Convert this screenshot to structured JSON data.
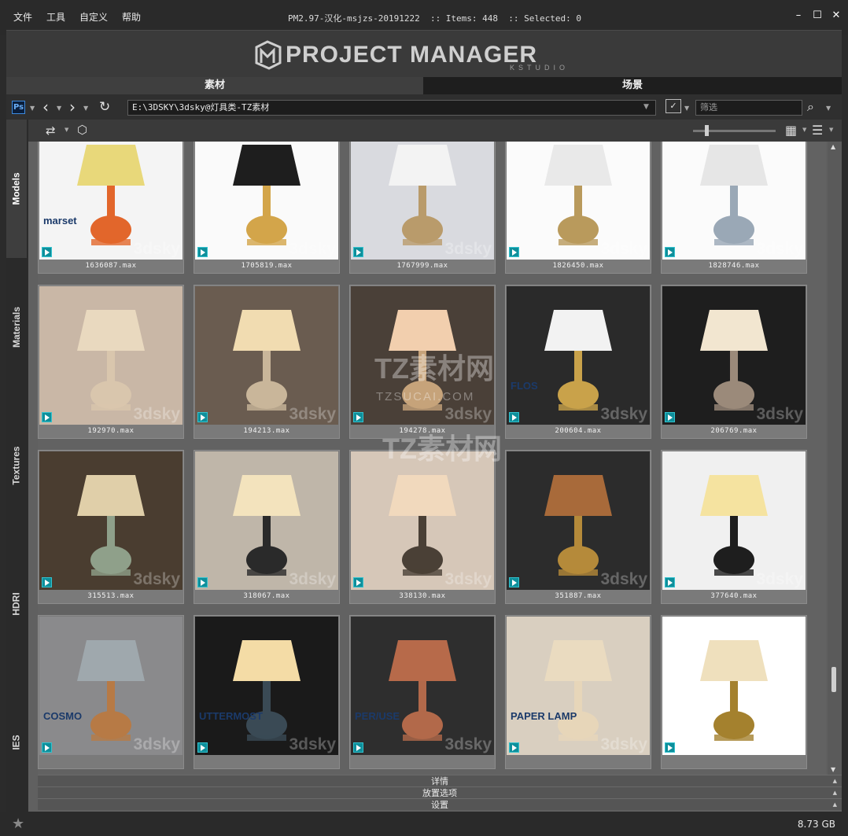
{
  "menu": [
    "文件",
    "工具",
    "自定义",
    "帮助"
  ],
  "app_info": "PM2.97-汉化-msjzs-20191222  :: Items: 448  :: Selected: 0",
  "window_controls": [
    "–",
    "☐",
    "✕"
  ],
  "banner": {
    "title": "PROJECT MANAGER",
    "subtitle": "KSTUDIO"
  },
  "tabs": {
    "materials": "素材",
    "scenes": "场景"
  },
  "addressbar": {
    "ps_label": "Ps",
    "path": "E:\\3DSKY\\3dsky@灯具类-TZ素材",
    "filter_placeholder": "筛选"
  },
  "sidetabs": [
    "Models",
    "Materials",
    "Textures",
    "HDRI",
    "IES"
  ],
  "watermark_text": "3dsky",
  "overlay": {
    "main": "TZ素材网",
    "sub": "TZSUCAI.COM"
  },
  "thumbnails": [
    {
      "name": "1636087.max",
      "bg": "#f4f4f4",
      "accent": "#e2662b",
      "brand": "marset",
      "shade": "#e8d87a"
    },
    {
      "name": "1705819.max",
      "bg": "#fafafa",
      "accent": "#d3a54a",
      "brand": "",
      "shade": "#1e1e1e"
    },
    {
      "name": "1767999.max",
      "bg": "#d9dadf",
      "accent": "#b99b6b",
      "brand": "",
      "shade": "#f3f3f3"
    },
    {
      "name": "1826450.max",
      "bg": "#fbfbfb",
      "accent": "#b99a5c",
      "brand": "",
      "shade": "#e9e9e9"
    },
    {
      "name": "1828746.max",
      "bg": "#fbfbfb",
      "accent": "#9aa8b6",
      "brand": "",
      "shade": "#e6e6e6"
    },
    {
      "name": "192970.max",
      "bg": "#c9b7a6",
      "accent": "#d9c6ad",
      "brand": "",
      "shade": "#e9d9bf"
    },
    {
      "name": "194213.max",
      "bg": "#6a5c50",
      "accent": "#c9b69a",
      "brand": "",
      "shade": "#f1dcb1"
    },
    {
      "name": "194278.max",
      "bg": "#4a4038",
      "accent": "#c6a37a",
      "brand": "",
      "shade": "#f2cfae"
    },
    {
      "name": "200604.max",
      "bg": "#2a2a2a",
      "accent": "#c9a24a",
      "brand": "FLOS",
      "shade": "#f2f2f2"
    },
    {
      "name": "206769.max",
      "bg": "#1e1e1e",
      "accent": "#9b8a7a",
      "brand": "",
      "shade": "#f2e6d0"
    },
    {
      "name": "315513.max",
      "bg": "#4a3d30",
      "accent": "#8fa08a",
      "brand": "",
      "shade": "#e0cfa9"
    },
    {
      "name": "318067.max",
      "bg": "#bfb6a9",
      "accent": "#2a2a2a",
      "brand": "",
      "shade": "#f3e3bd"
    },
    {
      "name": "338130.max",
      "bg": "#d6c7b8",
      "accent": "#4a4036",
      "brand": "",
      "shade": "#f1d9bd"
    },
    {
      "name": "351887.max",
      "bg": "#2c2c2c",
      "accent": "#b58a3a",
      "brand": "",
      "shade": "#a86a3a"
    },
    {
      "name": "377640.max",
      "bg": "#f0f0f0",
      "accent": "#1e1e1e",
      "brand": "",
      "shade": "#f5e3a0"
    },
    {
      "name": "",
      "bg": "#8a8a8c",
      "accent": "#b77a45",
      "brand": "COSMO",
      "shade": "#9fa8ad"
    },
    {
      "name": "",
      "bg": "#1a1a1a",
      "accent": "#3a4a55",
      "brand": "UTTERMOST",
      "shade": "#f4dca6"
    },
    {
      "name": "",
      "bg": "#2e2e2e",
      "accent": "#b2694a",
      "brand": "PER/USE",
      "shade": "#b76a4a"
    },
    {
      "name": "",
      "bg": "#d9cfc0",
      "accent": "#e7d6b9",
      "brand": "PAPER LAMP",
      "shade": "#eadbc0"
    },
    {
      "name": "",
      "bg": "#ffffff",
      "accent": "#a4812e",
      "brand": "",
      "shade": "#efe0bd"
    }
  ],
  "accordions": [
    "详情",
    "放置选项",
    "设置"
  ],
  "status": {
    "disk": "8.73 GB"
  }
}
